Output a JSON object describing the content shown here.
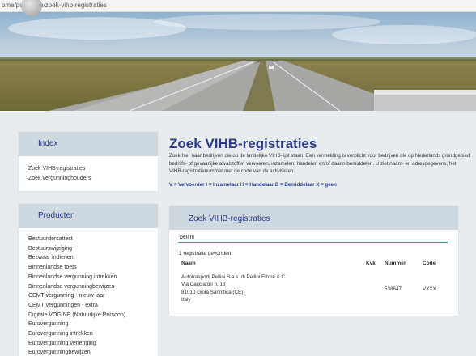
{
  "browser": {
    "url": "ome/publicatie/zoek-vihb-registraties"
  },
  "sidebar": {
    "index_title": "Index",
    "index_items": [
      "Zoek VIHB-registraties",
      "Zoek vergunninghouders"
    ],
    "producten_title": "Producten",
    "producten_items": [
      "Bestuurdersattest",
      "Bestuurswijziging",
      "Bezwaar indienen",
      "Binnenlandse toets",
      "Binnenlandse vergunning intrekken",
      "Binnenlandse vergunningbewijzen",
      "CEMT vergunning - nieuw jaar",
      "CEMT vergunningen - extra",
      "Digitale VOG NP (Natuurlijke Persoon)",
      "Eurovergunning",
      "Eurovergunning intrekken",
      "Eurovergunning verlenging",
      "Eurovergunningbewijzen"
    ]
  },
  "main": {
    "title": "Zoek VIHB-registraties",
    "intro": "Zoek hier naar bedrijven die op de landelijke VIHB-lijst staan. Een vermelding is verplicht voor bedrijven die op Nederlands grondgebied bedrijfs- of gevaarlijke afvalstoffen vervoeren, inzamelen, handelen en/of daarin bemiddelen. U ziet naam- en adresgegevens, het VIHB-registratienummer met de code van de activiteiten.",
    "legend": "V = Vervoerder    I = Inzamelaar    H = Handelaar    B = Bemiddelaar    X = geen"
  },
  "search": {
    "panel_title": "Zoek VIHB-registraties",
    "value": "pellini",
    "result_count": "1 registratie gevonden.",
    "columns": {
      "naam": "Naam",
      "kvk": "Kvk",
      "nummer": "Nummer",
      "code": "Code"
    },
    "results": [
      {
        "naam": "Autotrasporti Pellini S.a.s. di Pellini Ettore & C.",
        "adres": "Via Cacciatori n. 18",
        "plaats": "81010 Gioia Sannitica (CE)",
        "land": "Italy",
        "kvk": "",
        "nummer": "538647",
        "code": "VXXX"
      }
    ]
  },
  "colors": {
    "title_blue": "#2b3b8c",
    "panel_header": "#cfd8de",
    "input_underline": "#3a9e8e",
    "page_bg": "#e9ecef"
  }
}
